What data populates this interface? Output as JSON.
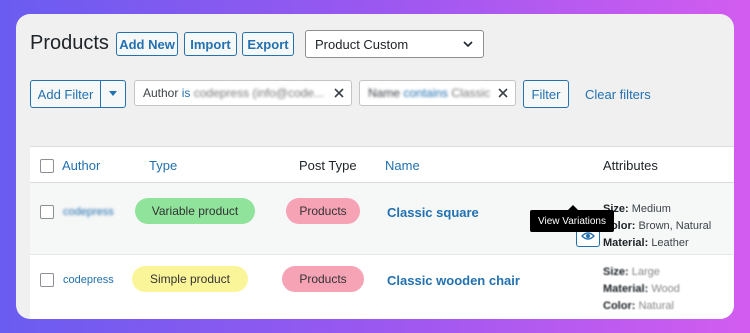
{
  "page": {
    "title": "Products"
  },
  "header_buttons": {
    "add_new": "Add New",
    "import": "Import",
    "export": "Export"
  },
  "view_select": {
    "value": "Product Custom"
  },
  "filters": {
    "add_filter": "Add Filter",
    "chips": [
      {
        "field": "Author",
        "operator": "is",
        "value": "codepress (info@code..."
      },
      {
        "field": "Name",
        "operator": "contains",
        "value": "Classic"
      }
    ],
    "filter_button": "Filter",
    "clear_filters": "Clear filters"
  },
  "table": {
    "columns": [
      "Author",
      "Type",
      "Post Type",
      "Name",
      "Attributes"
    ],
    "rows": [
      {
        "author": "codepress",
        "type": "Variable product",
        "post_type": "Products",
        "name": "Classic square",
        "attributes": {
          "size": "Medium",
          "color": "Brown, Natural",
          "material": "Leather"
        }
      },
      {
        "author": "codepress",
        "type": "Simple product",
        "post_type": "Products",
        "name": "Classic wooden chair",
        "attributes": {
          "size": "Large",
          "material": "Wood",
          "color": "Natural"
        }
      }
    ],
    "attribute_labels": {
      "size": "Size:",
      "color": "Color:",
      "material": "Material:"
    },
    "tooltip": "View Variations"
  },
  "colors": {
    "accent": "#2271b1",
    "variable_pill": "#8fe39a",
    "simple_pill": "#fbf59a",
    "post_type_pill": "#f6a3b5"
  }
}
